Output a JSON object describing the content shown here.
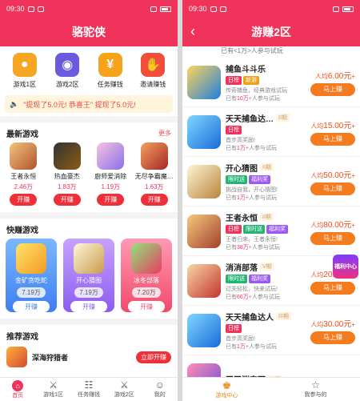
{
  "status": {
    "time": "09:30",
    "battery": "…"
  },
  "left": {
    "title": "骆驼侠",
    "categories": [
      {
        "label": "游戏1区"
      },
      {
        "label": "游戏2区"
      },
      {
        "label": "任务赚钱"
      },
      {
        "label": "邀请赚钱"
      }
    ],
    "notice": "\"提现了5.0元! 恭喜王\" 提现了5.0元!",
    "latest": {
      "heading": "最新游戏",
      "more": "更多",
      "games": [
        {
          "name": "王者永恒",
          "count": "2.46万",
          "btn": "开赚"
        },
        {
          "name": "热血豪杰",
          "count": "1.83万",
          "btn": "开赚"
        },
        {
          "name": "廚师爱消除",
          "count": "1.19万",
          "btn": "开赚"
        },
        {
          "name": "无尽争霸魔…",
          "count": "1.63万",
          "btn": "开赚"
        }
      ]
    },
    "quick": {
      "heading": "快赚游戏",
      "cards": [
        {
          "name": "金矿贪吃蛇",
          "count": "7.19万",
          "btn": "开赚"
        },
        {
          "name": "开心猜图",
          "count": "7.19万",
          "btn": "开赚"
        },
        {
          "name": "冰冬部落",
          "count": "7.20万",
          "btn": "开赚"
        }
      ]
    },
    "recommend": {
      "heading": "推荐游戏",
      "name": "深海狩猎者",
      "btn": "立即开赚"
    },
    "tabs": [
      {
        "label": "首页",
        "icon": "⌂"
      },
      {
        "label": "游戏1区",
        "icon": "⚔"
      },
      {
        "label": "任务赚钱",
        "icon": "☷"
      },
      {
        "label": "游戏2区",
        "icon": "⚔"
      },
      {
        "label": "我的",
        "icon": "☺"
      }
    ]
  },
  "right": {
    "title": "游赚2区",
    "partial": "已有<1万>人参与试玩",
    "items": [
      {
        "name": "捕鱼斗斗乐",
        "period": "",
        "tags": [
          "日榜",
          "新游"
        ],
        "desc": "传奇捕鱼，经典游戏试玩",
        "pre": "已有",
        "num": "10万",
        "post": "+人参与试玩",
        "reward": "6.00元",
        "btn": "马上赚"
      },
      {
        "name": "天天捕鱼达…",
        "period": "II期",
        "tags": [
          "日榜"
        ],
        "desc": "首步高奖励!",
        "pre": "已有",
        "num": "1万",
        "post": "+人参与试玩",
        "reward": "15.00元",
        "btn": "马上赚"
      },
      {
        "name": "开心猜图",
        "period": "II期",
        "tags": [
          "限时送",
          "福利奖"
        ],
        "desc": "挑战自我，开心猜图!",
        "pre": "已有",
        "num": "1万",
        "post": "+人参与试玩",
        "reward": "50.00元",
        "btn": "马上赚"
      },
      {
        "name": "王者永恒",
        "period": "II期",
        "tags": [
          "日榜",
          "限时送",
          "福利奖"
        ],
        "desc": "王者归来，王者永恒!",
        "pre": "已有",
        "num": "38万",
        "post": "+人参与试玩",
        "reward": "80.00元",
        "btn": "马上赚"
      },
      {
        "name": "消消部落",
        "period": "V期",
        "tags": [
          "限时送",
          "福利奖"
        ],
        "desc": "过关轻松，快来试玩!",
        "pre": "已有",
        "num": "66万",
        "post": "+人参与试玩",
        "reward": "20.00元",
        "btn": "马上赚"
      },
      {
        "name": "天天捕鱼达人",
        "period": "III期",
        "tags": [
          "日榜"
        ],
        "desc": "首步高奖励!",
        "pre": "已有",
        "num": "1万",
        "post": "+人参与试玩",
        "reward": "30.00元",
        "btn": "马上赚"
      },
      {
        "name": "天天消宝石",
        "period": "V期",
        "tags": [],
        "desc": "",
        "pre": "",
        "num": "",
        "post": "",
        "reward": "",
        "btn": ""
      }
    ],
    "reward_prefix": "人均",
    "float_label": "福利中心",
    "tabs": [
      {
        "label": "游戏中心",
        "icon": "♚"
      },
      {
        "label": "我参与的",
        "icon": "☆"
      }
    ]
  },
  "colors": {
    "brand": "#f0335a",
    "button": "#f57b1f"
  }
}
